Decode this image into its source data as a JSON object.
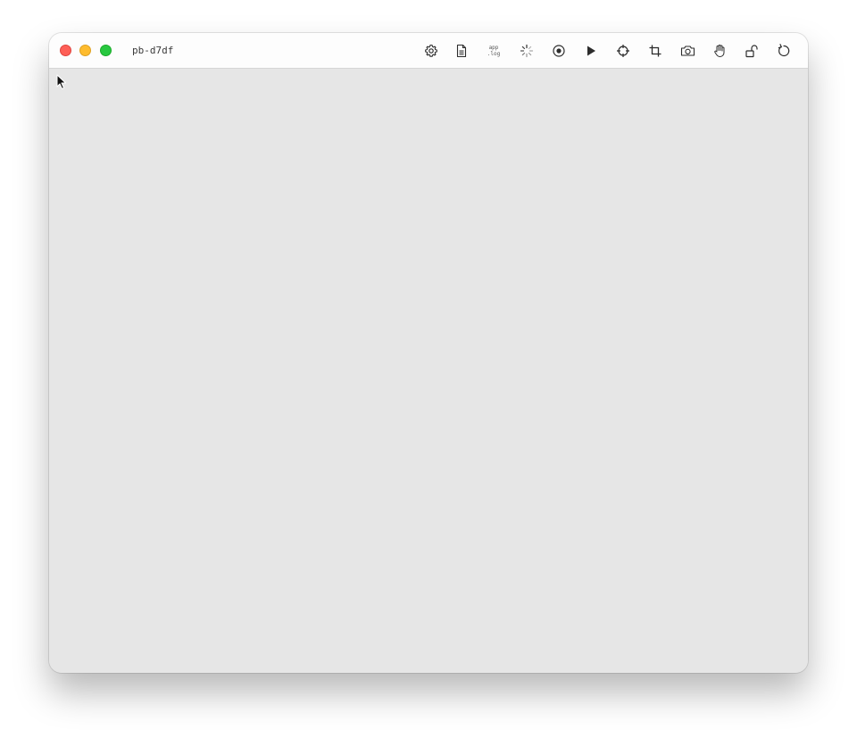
{
  "window": {
    "title": "pb-d7df",
    "traffic_lights": [
      "close",
      "minimize",
      "maximize"
    ]
  },
  "toolbar": {
    "items": [
      {
        "icon": "gear-icon"
      },
      {
        "icon": "document-icon"
      },
      {
        "icon": "app-log-icon",
        "line1": "app",
        "line2": ".log"
      },
      {
        "icon": "loading-spinner-icon"
      },
      {
        "icon": "record-icon"
      },
      {
        "icon": "play-icon"
      },
      {
        "icon": "crosshair-icon"
      },
      {
        "icon": "crop-icon"
      },
      {
        "icon": "camera-icon"
      },
      {
        "icon": "hand-icon"
      },
      {
        "icon": "unlock-icon"
      },
      {
        "icon": "rotate-icon"
      }
    ]
  },
  "colors": {
    "close": "#fe5f57",
    "minimize": "#febc2e",
    "maximize": "#28c840",
    "content_bg": "#e6e6e6",
    "titlebar_bg": "#fdfdfd"
  }
}
